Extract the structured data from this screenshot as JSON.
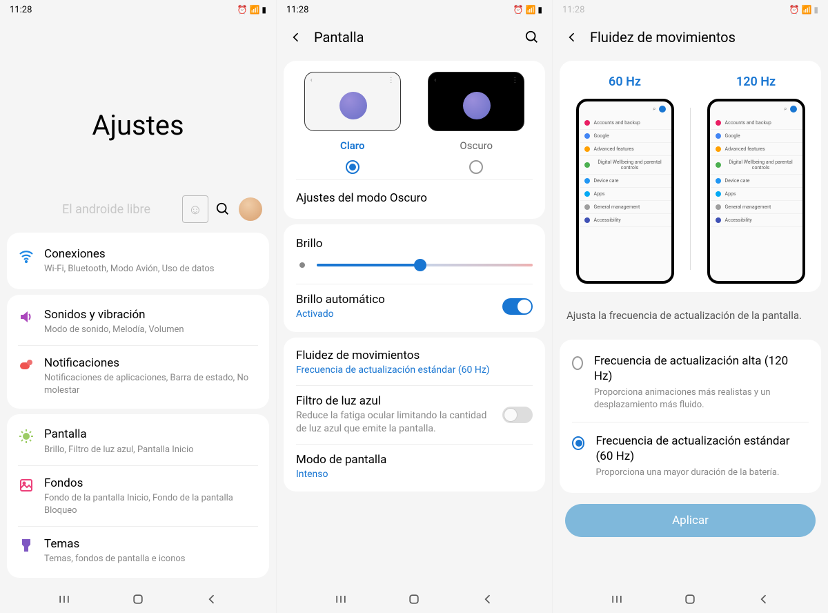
{
  "status": {
    "time": "11:28",
    "icons": "⏰ 📶 ▮"
  },
  "screen1": {
    "title": "Ajustes",
    "watermark": "El androide libre",
    "items": [
      {
        "icon": "wifi",
        "color": "#1e88e5",
        "title": "Conexiones",
        "sub": "Wi-Fi, Bluetooth, Modo Avión, Uso de datos"
      },
      {
        "icon": "sound",
        "color": "#ab47bc",
        "title": "Sonidos y vibración",
        "sub": "Modo de sonido, Melodía, Volumen"
      },
      {
        "icon": "notif",
        "color": "#ef5350",
        "title": "Notificaciones",
        "sub": "Notificaciones de aplicaciones, Barra de estado, No molestar"
      },
      {
        "icon": "display",
        "color": "#9ccc65",
        "title": "Pantalla",
        "sub": "Brillo, Filtro de luz azul, Pantalla Inicio"
      },
      {
        "icon": "wallpaper",
        "color": "#ec407a",
        "title": "Fondos",
        "sub": "Fondo de la pantalla Inicio, Fondo de la pantalla Bloqueo"
      },
      {
        "icon": "themes",
        "color": "#7e57c2",
        "title": "Temas",
        "sub": "Temas, fondos de pantalla e iconos"
      }
    ]
  },
  "screen2": {
    "title": "Pantalla",
    "light": "Claro",
    "dark": "Oscuro",
    "darkModeSettings": "Ajustes del modo Oscuro",
    "brightness": "Brillo",
    "autoBrightness": "Brillo automático",
    "autoBrightnessState": "Activado",
    "motion": "Fluidez de movimientos",
    "motionValue": "Frecuencia de actualización estándar (60 Hz)",
    "blueLight": "Filtro de luz azul",
    "blueLightSub": "Reduce la fatiga ocular limitando la cantidad de luz azul que emite la pantalla.",
    "screenMode": "Modo de pantalla",
    "screenModeValue": "Intenso"
  },
  "screen3": {
    "title": "Fluidez de movimientos",
    "hz60": "60 Hz",
    "hz120": "120 Hz",
    "preview_items": [
      {
        "color": "#e91e63",
        "label": "Accounts and backup"
      },
      {
        "color": "#4285f4",
        "label": "Google"
      },
      {
        "color": "#ffa000",
        "label": "Advanced features"
      },
      {
        "color": "#4caf50",
        "label": "Digital Wellbeing and parental controls"
      },
      {
        "color": "#2196f3",
        "label": "Device care"
      },
      {
        "color": "#03a9f4",
        "label": "Apps"
      },
      {
        "color": "#9e9e9e",
        "label": "General management"
      },
      {
        "color": "#3f51b5",
        "label": "Accessibility"
      }
    ],
    "desc": "Ajusta la frecuencia de actualización de la pantalla.",
    "optHigh": "Frecuencia de actualización alta (120 Hz)",
    "optHighSub": "Proporciona animaciones más realistas y un desplazamiento más fluido.",
    "optStd": "Frecuencia de actualización estándar (60 Hz)",
    "optStdSub": "Proporciona una mayor duración de la batería.",
    "apply": "Aplicar"
  }
}
